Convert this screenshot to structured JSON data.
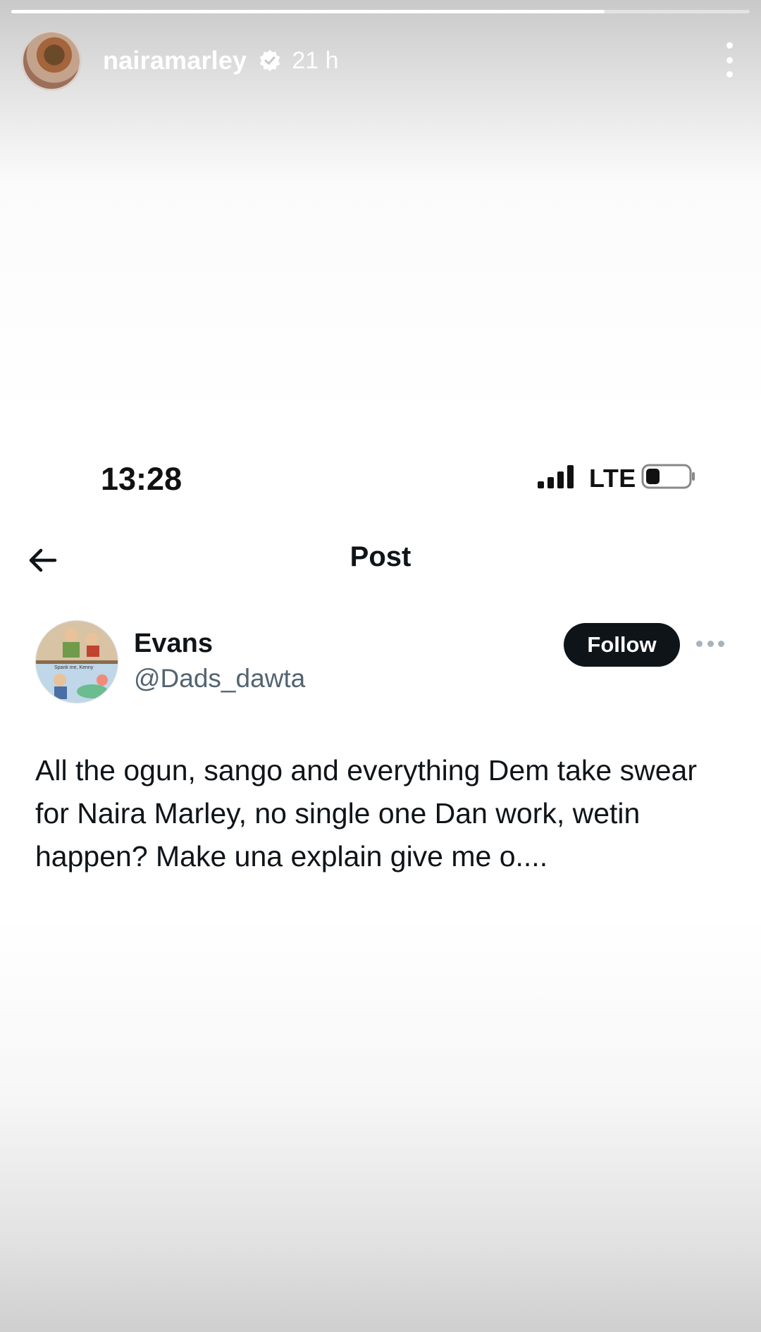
{
  "story": {
    "username": "nairamarley",
    "time_ago": "21 h",
    "progress_fraction": 0.803,
    "verified": true
  },
  "embedded_screenshot": {
    "status_bar": {
      "time": "13:28",
      "network": "LTE"
    },
    "nav": {
      "title": "Post"
    },
    "author": {
      "name": "Evans",
      "handle": "@Dads_dawta",
      "avatar_caption": "Spank me, Kenny",
      "follow_label": "Follow"
    },
    "post_text": "All the ogun, sango and everything Dem take swear for Naira Marley, no single one Dan work, wetin happen? Make una explain give me o...."
  },
  "colors": {
    "follow_bg": "#0f1419",
    "handle": "#536471",
    "text": "#0f1419"
  }
}
